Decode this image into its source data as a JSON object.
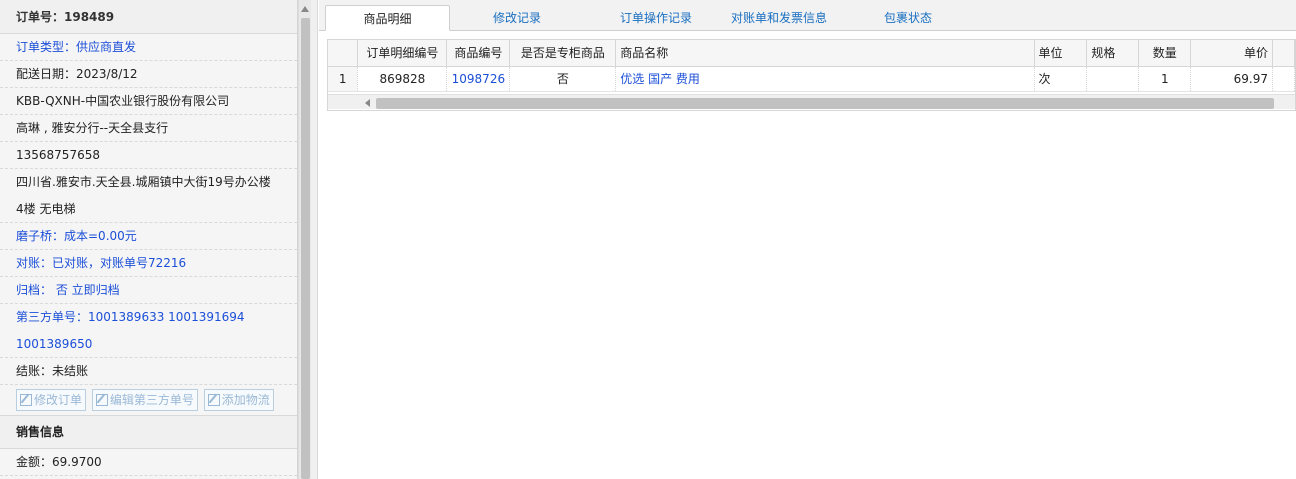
{
  "order": {
    "title": "订单号：198489",
    "type": "订单类型：供应商直发",
    "delivery_date": "配送日期：2023/8/12",
    "customer": "KBB-QXNH-中国农业银行股份有限公司",
    "contact": "高琳 , 雅安分行--天全县支行",
    "phone": "13568757658",
    "address_line1": "四川省.雅安市.天全县.城厢镇中大街19号办公楼",
    "address_line2": "4楼 无电梯",
    "grind": "磨子桥：成本=0.00元",
    "reconcile": "对账：已对账，对账单号72216",
    "archive": "归档： 否 立即归档",
    "third_party_line1": "第三方单号：1001389633 1001391694",
    "third_party_line2": "1001389650",
    "settle": "结账：未结账",
    "buttons": {
      "edit_order": "修改订单",
      "edit_third_party": "编辑第三方单号",
      "add_logistics": "添加物流"
    }
  },
  "sales": {
    "title": "销售信息",
    "amount": "金额：69.9700"
  },
  "tabs": [
    {
      "label": "商品明细",
      "active": true
    },
    {
      "label": "修改记录",
      "active": false
    },
    {
      "label": "订单操作记录",
      "active": false
    },
    {
      "label": "对账单和发票信息",
      "active": false
    },
    {
      "label": "包裹状态",
      "active": false
    }
  ],
  "grid": {
    "columns": [
      "",
      "订单明细编号",
      "商品编号",
      "是否是专柜商品",
      "商品名称",
      "单位",
      "规格",
      "数量",
      "单价"
    ],
    "rows": [
      [
        "1",
        "869828",
        "1098726",
        "否",
        "优选 国产 费用",
        "次",
        "",
        "1",
        "69.97"
      ]
    ]
  },
  "colors": {
    "link": "#1c4fd8",
    "tab_link": "#1a6fc0",
    "panel_bg": "#f5f5f5"
  }
}
